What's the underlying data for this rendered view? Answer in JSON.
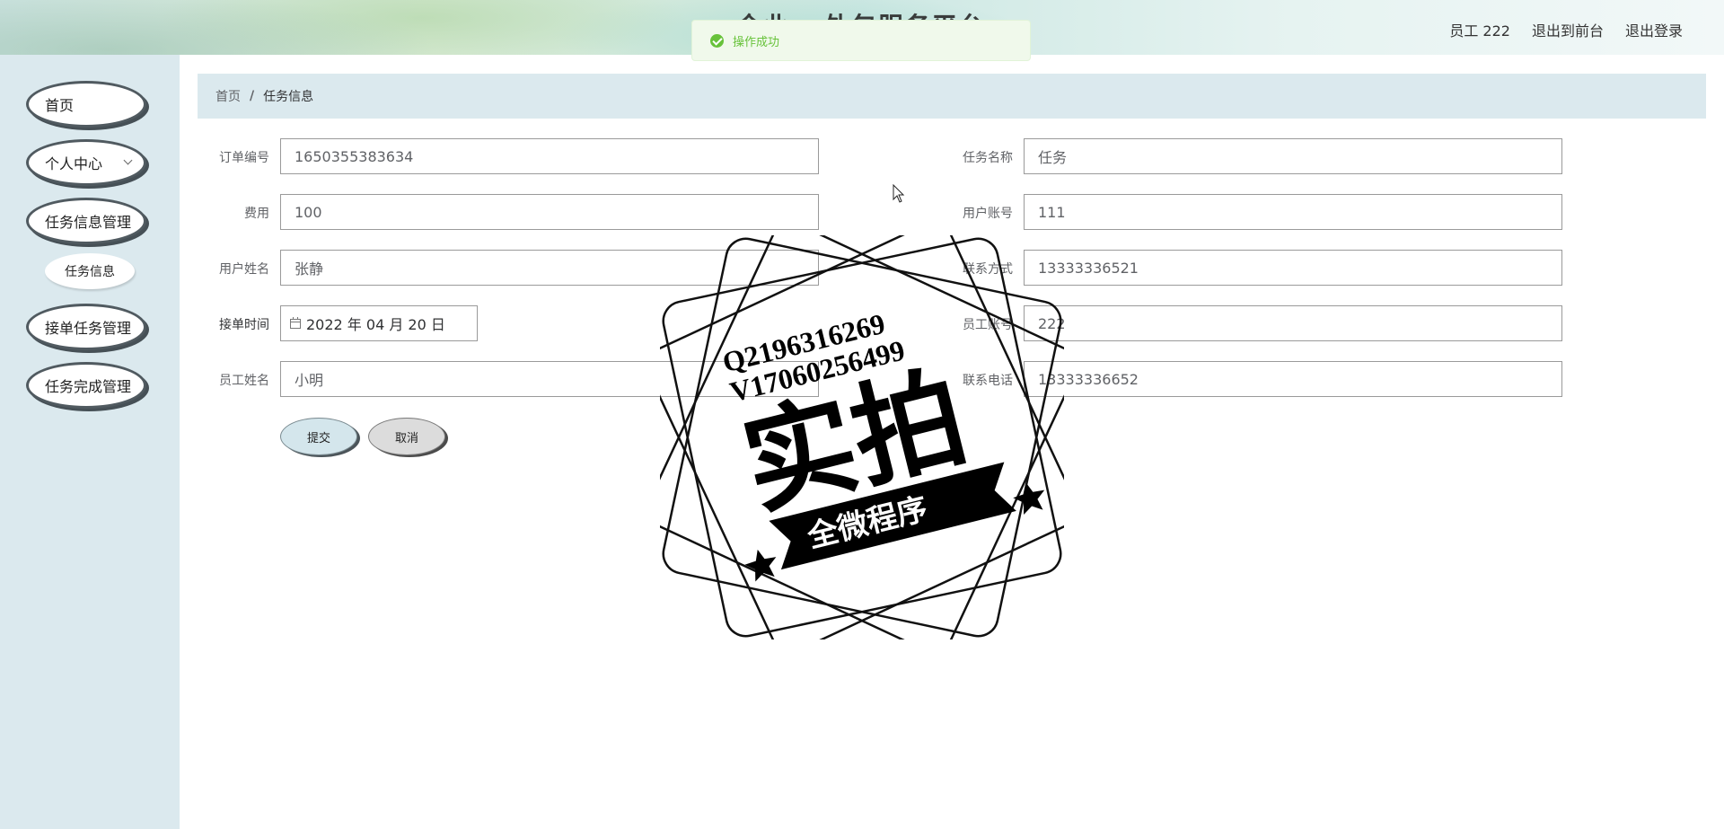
{
  "header": {
    "title": "企业...外包服务平台",
    "user": "员工 222",
    "back_to_front": "退出到前台",
    "logout": "退出登录"
  },
  "toast": {
    "message": "操作成功"
  },
  "sidebar": {
    "items": [
      {
        "label": "首页"
      },
      {
        "label": "个人中心"
      },
      {
        "label": "任务信息管理"
      },
      {
        "label": "接单任务管理"
      },
      {
        "label": "任务完成管理"
      }
    ],
    "submenu": {
      "label": "任务信息"
    }
  },
  "breadcrumb": {
    "home": "首页",
    "separator": "/",
    "current": "任务信息"
  },
  "form": {
    "order_no": {
      "label": "订单编号",
      "value": "1650355383634"
    },
    "task_name": {
      "label": "任务名称",
      "value": "任务"
    },
    "fee": {
      "label": "费用",
      "value": "100"
    },
    "user_account": {
      "label": "用户账号",
      "value": "111"
    },
    "user_name": {
      "label": "用户姓名",
      "value": "张静"
    },
    "contact": {
      "label": "联系方式",
      "value": "13333336521"
    },
    "accept_time": {
      "label": "接单时间",
      "value": "2022 年 04 月 20 日"
    },
    "staff_account": {
      "label": "员工账号",
      "value": "222"
    },
    "staff_name": {
      "label": "员工姓名",
      "value": "小明"
    },
    "staff_phone": {
      "label": "联系电话",
      "value": "13333336652"
    },
    "submit_label": "提交",
    "cancel_label": "取消"
  },
  "watermark": {
    "line1": "Q2196316269",
    "line2": "V17060256499",
    "main": "实拍",
    "ribbon": "全微程序"
  },
  "colors": {
    "sidebar_bg": "#dbe9ee",
    "toast_green": "#67c23a",
    "toast_bg": "#f0f9eb"
  }
}
